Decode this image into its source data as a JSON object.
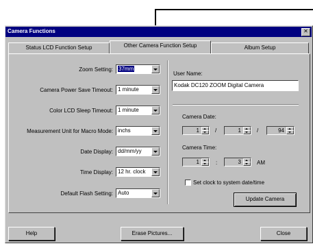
{
  "window": {
    "title": "Camera Functions",
    "close_glyph": "✕"
  },
  "tabs": [
    {
      "label": "Status LCD Function Setup"
    },
    {
      "label": "Other Camera Function Setup"
    },
    {
      "label": "Album Setup"
    }
  ],
  "left": {
    "zoom": {
      "label": "Zoom Setting:",
      "value": "37mm"
    },
    "power_save": {
      "label": "Camera Power Save Timeout:",
      "value": "1 minute"
    },
    "lcd_sleep": {
      "label": "Color LCD Sleep Timeout:",
      "value": "1 minute"
    },
    "macro_unit": {
      "label": "Measurement Unit for Macro Mode:",
      "value": "inchs"
    },
    "date_display": {
      "label": "Date Display:",
      "value": "dd/mm/yy"
    },
    "time_display": {
      "label": "Time Display:",
      "value": "12 hr. clock"
    },
    "flash": {
      "label": "Default Flash Setting:",
      "value": "Auto"
    }
  },
  "right": {
    "user_name_label": "User Name:",
    "user_name_value": "Kodak DC120 ZOOM Digital Camera",
    "camera_date_label": "Camera Date:",
    "date_day": "1",
    "date_month": "1",
    "date_year": "94",
    "date_sep": "/",
    "camera_time_label": "Camera Time:",
    "time_hour": "1",
    "time_min": "3",
    "time_sep": ":",
    "time_ampm": "AM",
    "set_clock_label": "Set clock to system date/time",
    "update_button": "Update Camera"
  },
  "footer": {
    "help": "Help",
    "erase": "Erase Pictures...",
    "close": "Close"
  }
}
